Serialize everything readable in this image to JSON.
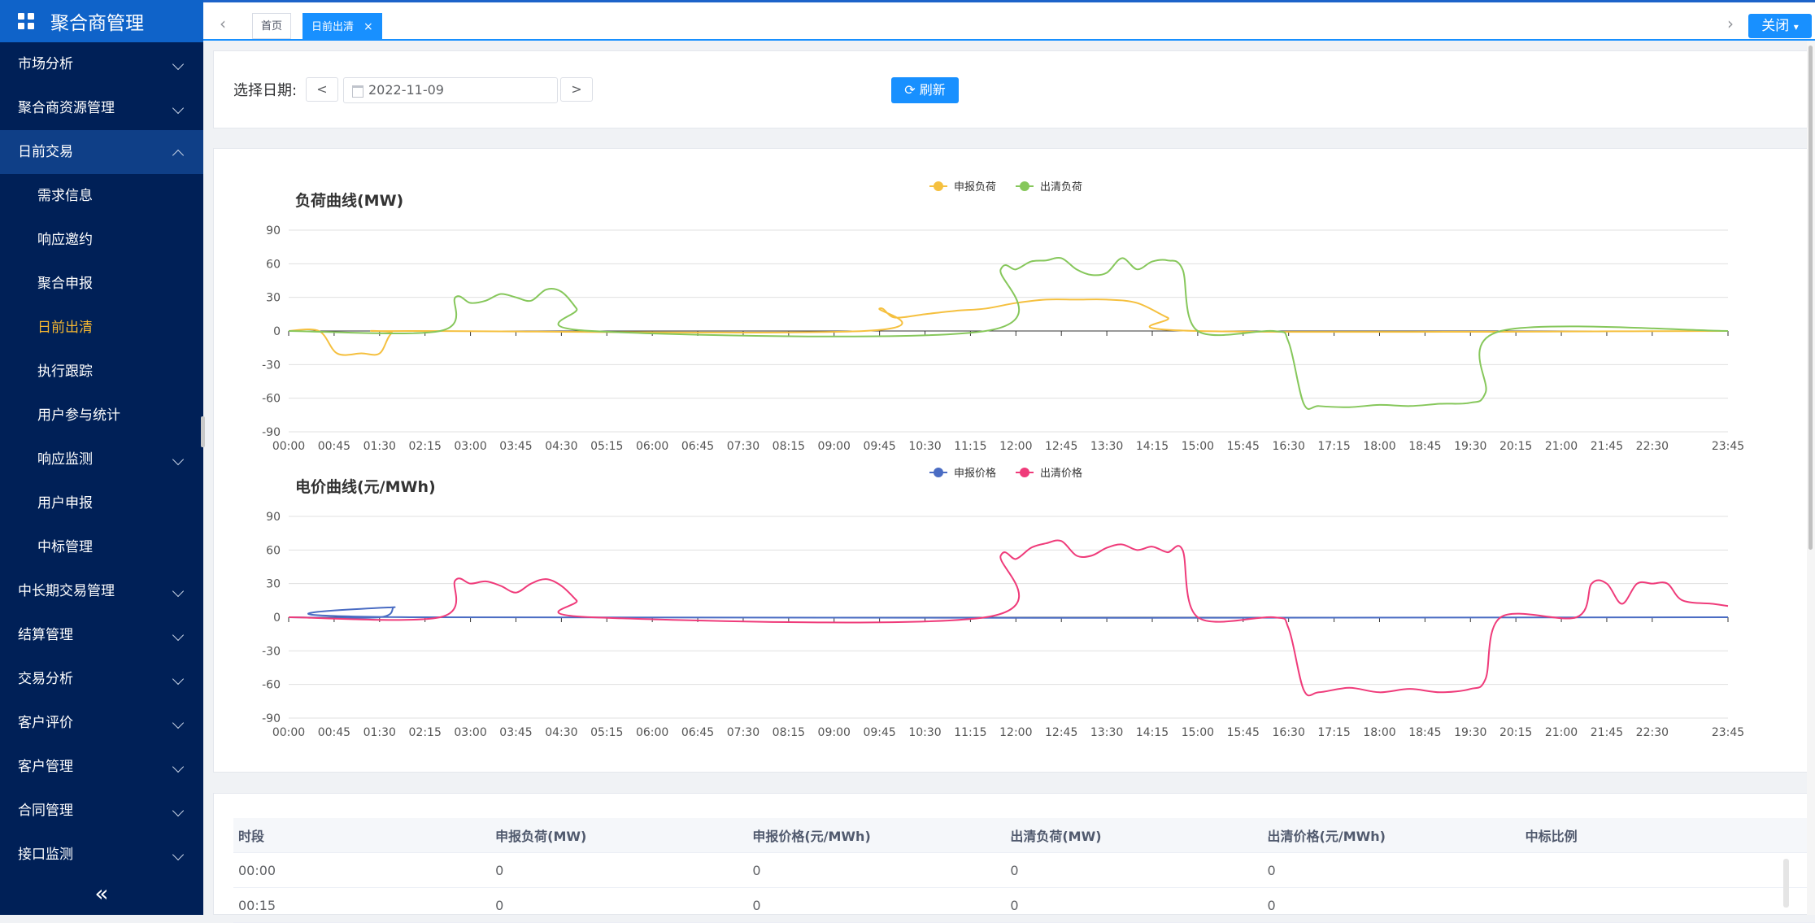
{
  "app": {
    "title": "聚合商管理"
  },
  "sidebar": {
    "items": [
      {
        "label": "市场分析",
        "chevron": "down"
      },
      {
        "label": "聚合商资源管理",
        "chevron": "down"
      },
      {
        "label": "日前交易",
        "chevron": "up",
        "open": true
      },
      {
        "label": "需求信息",
        "sub": true
      },
      {
        "label": "响应邀约",
        "sub": true
      },
      {
        "label": "聚合申报",
        "sub": true
      },
      {
        "label": "日前出清",
        "sub": true,
        "active": true
      },
      {
        "label": "执行跟踪",
        "sub": true
      },
      {
        "label": "用户参与统计",
        "sub": true
      },
      {
        "label": "响应监测",
        "sub": true,
        "chevron": "down"
      },
      {
        "label": "用户申报",
        "sub": true
      },
      {
        "label": "中标管理",
        "sub": true
      },
      {
        "label": "中长期交易管理",
        "chevron": "down"
      },
      {
        "label": "结算管理",
        "chevron": "down"
      },
      {
        "label": "交易分析",
        "chevron": "down"
      },
      {
        "label": "客户评价",
        "chevron": "down"
      },
      {
        "label": "客户管理",
        "chevron": "down"
      },
      {
        "label": "合同管理",
        "chevron": "down"
      },
      {
        "label": "接口监测",
        "chevron": "down"
      }
    ],
    "collapse_glyph": "«"
  },
  "tabs": {
    "home": "首页",
    "current": "日前出清",
    "close_x": "×",
    "close_btn": "关闭"
  },
  "filter": {
    "label": "选择日期:",
    "date": "2022-11-09",
    "prev": "<",
    "next": ">",
    "refresh": "刷新"
  },
  "colors": {
    "declared_load": "#f5c03f",
    "cleared_load": "#86c75b",
    "declared_price": "#4a6cc3",
    "cleared_price": "#ef3b7a",
    "accent": "#1890ff"
  },
  "chart_data": [
    {
      "type": "line",
      "title": "负荷曲线(MW)",
      "ylim": [
        -90,
        90
      ],
      "yticks": [
        90,
        60,
        30,
        0,
        -30,
        -60,
        -90
      ],
      "x_tick_labels": [
        "00:00",
        "00:45",
        "01:30",
        "02:15",
        "03:00",
        "03:45",
        "04:30",
        "05:15",
        "06:00",
        "06:45",
        "07:30",
        "08:15",
        "09:00",
        "09:45",
        "10:30",
        "11:15",
        "12:00",
        "12:45",
        "13:30",
        "14:15",
        "15:00",
        "15:45",
        "16:30",
        "17:15",
        "18:00",
        "18:45",
        "19:30",
        "20:15",
        "21:00",
        "21:45",
        "22:30",
        "23:45"
      ],
      "x_unit": "hour",
      "series": [
        {
          "name": "申报负荷",
          "color": "#f5c03f",
          "points": [
            [
              0,
              0
            ],
            [
              0.5,
              0
            ],
            [
              0.8,
              -20
            ],
            [
              1.2,
              -20
            ],
            [
              1.5,
              -20
            ],
            [
              1.7,
              -2
            ],
            [
              2.0,
              0
            ],
            [
              9.5,
              0
            ],
            [
              9.75,
              20
            ],
            [
              10.0,
              12
            ],
            [
              10.5,
              15
            ],
            [
              11.0,
              18
            ],
            [
              11.5,
              20
            ],
            [
              12.0,
              25
            ],
            [
              12.5,
              28
            ],
            [
              13.0,
              28
            ],
            [
              13.5,
              28
            ],
            [
              14.0,
              25
            ],
            [
              14.5,
              12
            ],
            [
              15.0,
              0
            ],
            [
              23.75,
              0
            ]
          ]
        },
        {
          "name": "出清负荷",
          "color": "#86c75b",
          "points": [
            [
              0,
              0
            ],
            [
              2.5,
              0
            ],
            [
              2.75,
              30
            ],
            [
              3.0,
              25
            ],
            [
              3.25,
              27
            ],
            [
              3.5,
              33
            ],
            [
              3.75,
              30
            ],
            [
              4.0,
              27
            ],
            [
              4.25,
              37
            ],
            [
              4.5,
              35
            ],
            [
              4.75,
              20
            ],
            [
              5.0,
              0
            ],
            [
              11.5,
              0
            ],
            [
              11.75,
              55
            ],
            [
              12.0,
              55
            ],
            [
              12.25,
              62
            ],
            [
              12.5,
              63
            ],
            [
              12.75,
              65
            ],
            [
              13.0,
              55
            ],
            [
              13.25,
              50
            ],
            [
              13.5,
              52
            ],
            [
              13.75,
              65
            ],
            [
              14.0,
              55
            ],
            [
              14.25,
              62
            ],
            [
              14.5,
              63
            ],
            [
              14.75,
              55
            ],
            [
              15.0,
              0
            ],
            [
              16.25,
              0
            ],
            [
              16.5,
              -10
            ],
            [
              16.75,
              -65
            ],
            [
              17.0,
              -67
            ],
            [
              17.5,
              -68
            ],
            [
              18.0,
              -66
            ],
            [
              18.5,
              -67
            ],
            [
              19.0,
              -65
            ],
            [
              19.5,
              -64
            ],
            [
              19.75,
              -55
            ],
            [
              20.0,
              0
            ],
            [
              23.75,
              0
            ]
          ]
        }
      ]
    },
    {
      "type": "line",
      "title": "电价曲线(元/MWh)",
      "ylim": [
        -90,
        90
      ],
      "yticks": [
        90,
        60,
        30,
        0,
        -30,
        -60,
        -90
      ],
      "x_tick_labels": [
        "00:00",
        "00:45",
        "01:30",
        "02:15",
        "03:00",
        "03:45",
        "04:30",
        "05:15",
        "06:00",
        "06:45",
        "07:30",
        "08:15",
        "09:00",
        "09:45",
        "10:30",
        "11:15",
        "12:00",
        "12:45",
        "13:30",
        "14:15",
        "15:00",
        "15:45",
        "16:30",
        "17:15",
        "18:00",
        "18:45",
        "19:30",
        "20:15",
        "21:00",
        "21:45",
        "22:30",
        "23:45"
      ],
      "x_unit": "hour",
      "series": [
        {
          "name": "申报价格",
          "color": "#4a6cc3",
          "points": [
            [
              0,
              0
            ],
            [
              1.5,
              0
            ],
            [
              1.75,
              9
            ],
            [
              2.0,
              0
            ],
            [
              23.75,
              0
            ]
          ]
        },
        {
          "name": "出清价格",
          "color": "#ef3b7a",
          "points": [
            [
              0,
              0
            ],
            [
              2.5,
              0
            ],
            [
              2.75,
              33
            ],
            [
              3.0,
              30
            ],
            [
              3.25,
              32
            ],
            [
              3.5,
              28
            ],
            [
              3.75,
              22
            ],
            [
              4.0,
              30
            ],
            [
              4.25,
              34
            ],
            [
              4.5,
              28
            ],
            [
              4.75,
              15
            ],
            [
              5.0,
              0
            ],
            [
              11.5,
              0
            ],
            [
              11.75,
              55
            ],
            [
              12.0,
              52
            ],
            [
              12.25,
              62
            ],
            [
              12.5,
              66
            ],
            [
              12.75,
              68
            ],
            [
              13.0,
              55
            ],
            [
              13.25,
              55
            ],
            [
              13.5,
              62
            ],
            [
              13.75,
              65
            ],
            [
              14.0,
              60
            ],
            [
              14.25,
              63
            ],
            [
              14.5,
              58
            ],
            [
              14.75,
              60
            ],
            [
              15.0,
              0
            ],
            [
              16.25,
              0
            ],
            [
              16.5,
              -10
            ],
            [
              16.75,
              -65
            ],
            [
              17.0,
              -67
            ],
            [
              17.5,
              -63
            ],
            [
              18.0,
              -67
            ],
            [
              18.5,
              -64
            ],
            [
              19.0,
              -67
            ],
            [
              19.5,
              -64
            ],
            [
              19.75,
              -55
            ],
            [
              20.0,
              0
            ],
            [
              21.25,
              0
            ],
            [
              21.5,
              30
            ],
            [
              21.75,
              30
            ],
            [
              22.0,
              12
            ],
            [
              22.25,
              30
            ],
            [
              22.5,
              30
            ],
            [
              22.75,
              30
            ],
            [
              23.0,
              15
            ],
            [
              23.5,
              12
            ],
            [
              23.75,
              10
            ]
          ]
        }
      ]
    }
  ],
  "table": {
    "headers": [
      "时段",
      "申报负荷(MW)",
      "申报价格(元/MWh)",
      "出清负荷(MW)",
      "出清价格(元/MWh)",
      "中标比例"
    ],
    "rows": [
      [
        "00:00",
        "0",
        "0",
        "0",
        "0",
        ""
      ],
      [
        "00:15",
        "0",
        "0",
        "0",
        "0",
        ""
      ]
    ]
  }
}
